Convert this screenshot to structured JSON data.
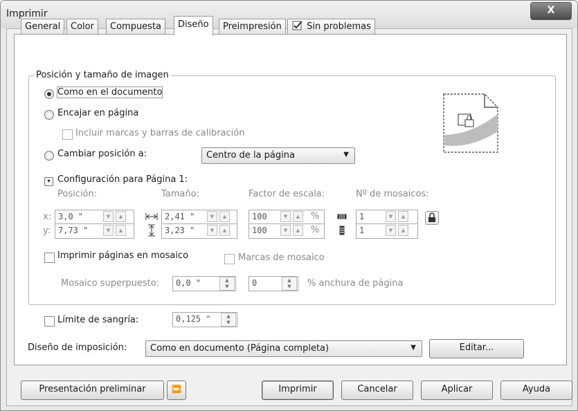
{
  "window": {
    "title": "Imprimir",
    "close_glyph": "X"
  },
  "tabs": [
    {
      "label": "General"
    },
    {
      "label": "Color"
    },
    {
      "label": "Compuesta"
    },
    {
      "label": "Diseño"
    },
    {
      "label": "Preimpresión"
    },
    {
      "label": "Sin problemas"
    }
  ],
  "image_position": {
    "group_label": "Posición y tamaño de imagen",
    "option_as_document": "Como en el documento",
    "option_fit_page": "Encajar en página",
    "include_marks": "Incluir marcas y barras de calibración",
    "option_reposition": "Cambiar posición a:",
    "reposition_value": "Centro de la página",
    "page_settings_label": "Configuración para Página 1:",
    "col_position": "Posición:",
    "col_size": "Tamaño:",
    "col_scale": "Factor de escala:",
    "col_tiles": "Nº de mosaicos:",
    "x_label": "x:",
    "y_label": "y:",
    "x_value": "3,0 \"",
    "y_value": "7,73 \"",
    "width_value": "2,41 \"",
    "height_value": "3,23 \"",
    "scale_x": "100",
    "scale_y": "100",
    "pct": "%",
    "tiles_x": "1",
    "tiles_y": "1"
  },
  "tiling": {
    "print_tiled": "Imprimir páginas en mosaico",
    "tile_marks": "Marcas de mosaico",
    "overlap_label": "Mosaico superpuesto:",
    "overlap_value": "0,0 \"",
    "overlap_pct": "0",
    "overlap_pct_label": "% anchura de página"
  },
  "bleed": {
    "label": "Límite de sangría:",
    "value": "0,125 \""
  },
  "imposition": {
    "label": "Diseño de imposición:",
    "value": "Como en documento (Página completa)",
    "edit_button": "Editar..."
  },
  "buttons": {
    "preview": "Presentación preliminar",
    "expand_glyph": "⏩",
    "print": "Imprimir",
    "cancel": "Cancelar",
    "apply": "Aplicar",
    "help": "Ayuda"
  },
  "icons": [
    "close-icon",
    "sin-problemas-icon",
    "dropdown-arrow-icon",
    "spin-up-icon",
    "spin-down-icon",
    "width-icon",
    "height-icon",
    "lock-icon",
    "page-preview-icon",
    "expand-icon"
  ]
}
